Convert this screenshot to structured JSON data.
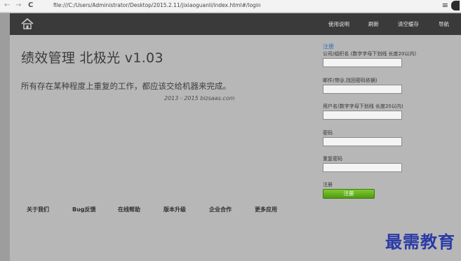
{
  "browser": {
    "back_glyph": "←",
    "forward_glyph": "→",
    "reload_glyph": "C",
    "address": "file:///C:/Users/Administrator/Desktop/2015.2.11/jixiaoguanli/index.html#/login",
    "menu_glyph": "≡"
  },
  "header": {
    "nav": [
      "使用说明",
      "刷新",
      "清空缓存",
      "导航"
    ]
  },
  "main": {
    "title": "绩效管理 北极光 v1.03",
    "tagline": "所有存在某种程度上重复的工作，都应该交给机器来完成。",
    "copyright": "2013 - 2015 bizsaas.com"
  },
  "footer": {
    "links": [
      "关于我们",
      "Bug反馈",
      "在线帮助",
      "版本升级",
      "企业合作",
      "更多应用"
    ]
  },
  "register": {
    "heading": "注册",
    "company_label": "公司/组织名 (数字字母下划线 长度20以内)",
    "email_label": "邮件(带@,找回密码依据)",
    "username_label": "用户名(数字字母下划线 长度20以内)",
    "password_label": "密码",
    "confirm_label": "重复密码",
    "submit_caption": "注册",
    "submit_label": "注册"
  },
  "watermark": "最需教育"
}
